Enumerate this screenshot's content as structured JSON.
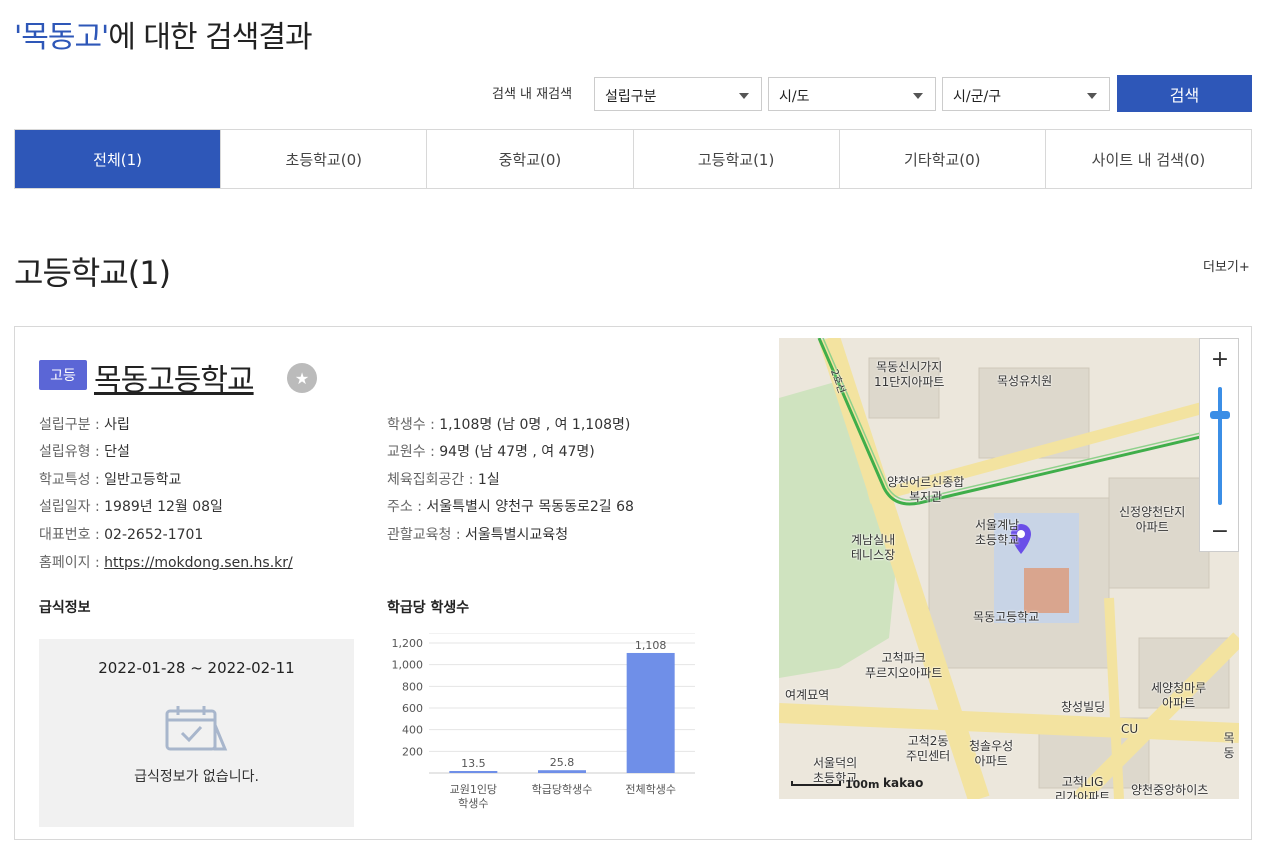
{
  "header": {
    "query_quoted": "'목동고'",
    "title_rest": "에 대한 검색결과"
  },
  "filters": {
    "label": "검색 내 재검색",
    "type_select": "설립구분",
    "city_select": "시/도",
    "district_select": "시/군/구",
    "search_button": "검색"
  },
  "tabs": [
    {
      "label": "전체(1)",
      "active": true
    },
    {
      "label": "초등학교(0)",
      "active": false
    },
    {
      "label": "중학교(0)",
      "active": false
    },
    {
      "label": "고등학교(1)",
      "active": false
    },
    {
      "label": "기타학교(0)",
      "active": false
    },
    {
      "label": "사이트 내 검색(0)",
      "active": false
    }
  ],
  "section": {
    "title": "고등학교(1)",
    "more": "더보기+"
  },
  "school": {
    "badge": "고등",
    "name": "목동고등학교",
    "left_info": [
      {
        "key": "설립구분 :",
        "value": "사립"
      },
      {
        "key": "설립유형 :",
        "value": "단설"
      },
      {
        "key": "학교특성 :",
        "value": "일반고등학교"
      },
      {
        "key": "설립일자 :",
        "value": "1989년 12월 08일"
      },
      {
        "key": "대표번호 :",
        "value": "02-2652-1701"
      },
      {
        "key": "홈페이지 :",
        "value": "https://mokdong.sen.hs.kr/"
      }
    ],
    "right_info": [
      {
        "key": "학생수 :",
        "value": "1,108명 (남 0명 , 여 1,108명)"
      },
      {
        "key": "교원수 :",
        "value": "94명 (남 47명 , 여 47명)"
      },
      {
        "key": "체육집회공간 :",
        "value": "1실"
      },
      {
        "key": "주소 :",
        "value": "서울특별시 양천구 목동동로2길 68"
      },
      {
        "key": "관할교육청 :",
        "value": "서울특별시교육청"
      }
    ]
  },
  "meal": {
    "title": "급식정보",
    "date_range": "2022-01-28 ~ 2022-02-11",
    "empty_text": "급식정보가 없습니다."
  },
  "chart_title": "학급당 학생수",
  "chart_data": {
    "type": "bar",
    "categories": [
      "교원1인당\n학생수",
      "학급당학생수",
      "전체학생수"
    ],
    "values": [
      13.5,
      25.8,
      1108
    ],
    "value_labels": [
      "13.5",
      "25.8",
      "1,108"
    ],
    "yticks": [
      "1,200",
      "1,000",
      "800",
      "600",
      "400",
      "200"
    ],
    "ytick_values": [
      1200,
      1000,
      800,
      600,
      400,
      200
    ],
    "ylim": [
      0,
      1200
    ],
    "bar_color": "#6f8fe8",
    "grid": true
  },
  "map": {
    "labels": [
      "목동신시가지\n11단지아파트",
      "목성유치원",
      "양천어르신종합\n복지관",
      "서울계남\n초등학교",
      "계남실내\n테니스장",
      "신정양천단지\n아파트",
      "목동고등학교",
      "고척파크\n푸르지오아파트",
      "여계묘역",
      "세양청마루\n아파트",
      "창성빌딩",
      "CU",
      "고척2동\n주민센터",
      "청솔우성\n아파트",
      "서울덕의\n초등학교",
      "고척LIG\n리가아파트",
      "양천중앙하이츠",
      "목동",
      "2호선"
    ],
    "zoom_in": "+",
    "zoom_out": "−",
    "scale": "100m",
    "brand": "kakao"
  },
  "colors": {
    "accent": "#2e57b8",
    "badge": "#5b66d6"
  }
}
